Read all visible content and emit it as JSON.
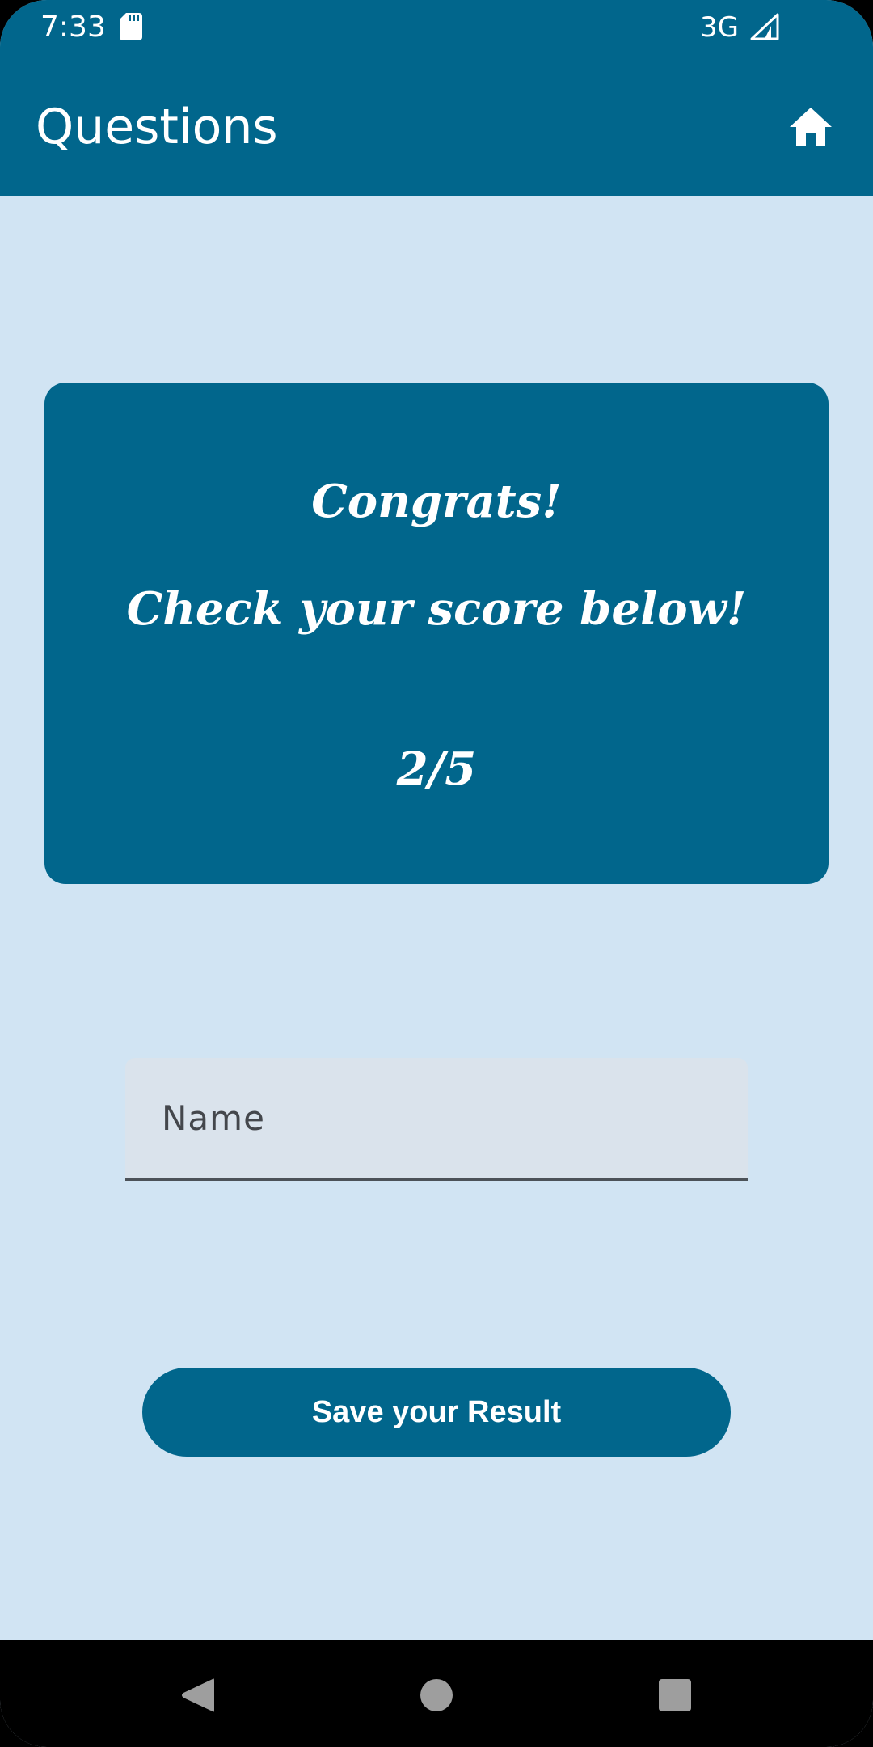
{
  "status_bar": {
    "time": "7:33",
    "network": "3G",
    "icons": [
      "sd-card-icon",
      "signal-icon"
    ]
  },
  "app_bar": {
    "title": "Questions",
    "home_icon": "home-icon"
  },
  "result_card": {
    "congrats": "Congrats!",
    "instruction": "Check your score below!",
    "score": "2/5"
  },
  "form": {
    "name_placeholder": "Name",
    "name_value": "",
    "save_label": "Save your Result"
  },
  "nav_bar": {
    "icons": [
      "back-icon",
      "home-circle-icon",
      "recents-icon"
    ]
  },
  "colors": {
    "primary": "#01668c",
    "background": "#d1e4f3",
    "input_fill": "#dae3ec",
    "on_primary": "#ffffff",
    "nav_bar": "#000000"
  }
}
